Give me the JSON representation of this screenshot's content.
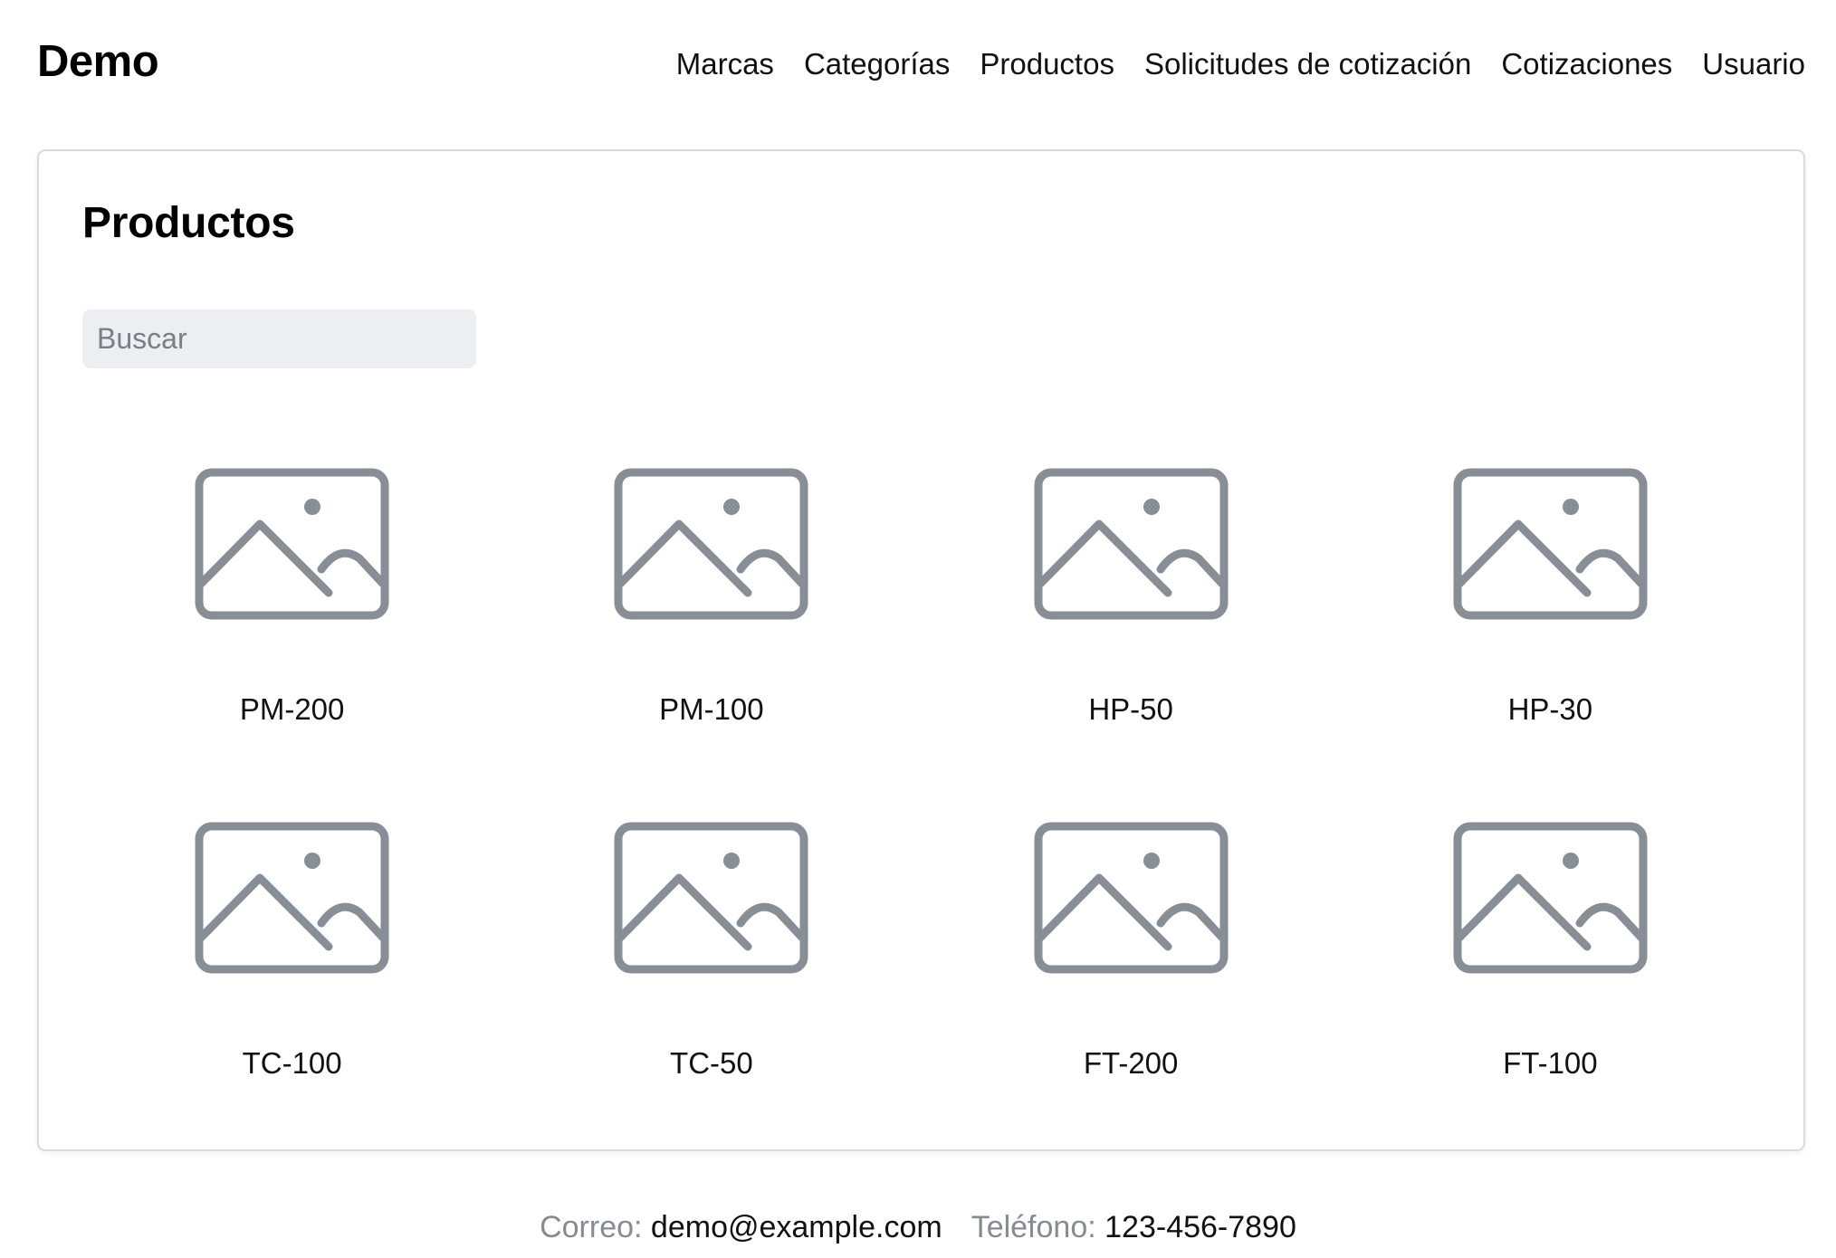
{
  "header": {
    "brand": "Demo",
    "nav": [
      "Marcas",
      "Categorías",
      "Productos",
      "Solicitudes de cotización",
      "Cotizaciones",
      "Usuario"
    ]
  },
  "main": {
    "title": "Productos",
    "search": {
      "placeholder": "Buscar",
      "value": ""
    },
    "products": [
      {
        "name": "PM-200",
        "icon": "image-placeholder-icon"
      },
      {
        "name": "PM-100",
        "icon": "image-placeholder-icon"
      },
      {
        "name": "HP-50",
        "icon": "image-placeholder-icon"
      },
      {
        "name": "HP-30",
        "icon": "image-placeholder-icon"
      },
      {
        "name": "TC-100",
        "icon": "image-placeholder-icon"
      },
      {
        "name": "TC-50",
        "icon": "image-placeholder-icon"
      },
      {
        "name": "FT-200",
        "icon": "image-placeholder-icon"
      },
      {
        "name": "FT-100",
        "icon": "image-placeholder-icon"
      }
    ]
  },
  "footer": {
    "email_label": "Correo:",
    "email": "demo@example.com",
    "phone_label": "Teléfono:",
    "phone": "123-456-7890"
  },
  "colors": {
    "icon_stroke": "#878e96",
    "search_bg": "#eceef1",
    "card_border": "#d9dbdf",
    "muted_text": "#868b92"
  }
}
